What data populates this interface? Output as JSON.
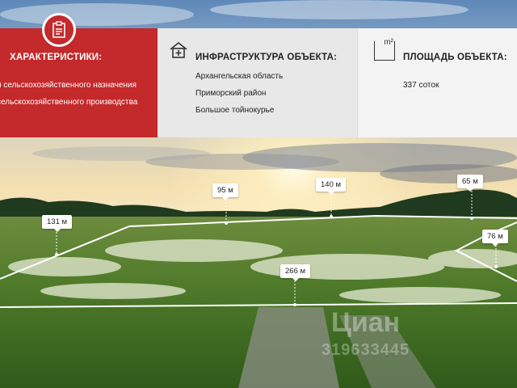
{
  "characteristics": {
    "title": "ХАРАКТЕРИСТИКИ:",
    "lines": [
      "и сельскохозяйственного назначения",
      "сельскохозяйственного производства"
    ],
    "badge_icon": "clipboard-icon"
  },
  "infrastructure": {
    "title": "ИНФРАСТРУКТУРА ОБЪЕКТА:",
    "icon": "house-plus-icon",
    "lines": [
      "Архангельская область",
      "Приморский район",
      "Большое тойнокурье"
    ]
  },
  "area": {
    "title": "ПЛОЩАДЬ ОБЪЕКТА:",
    "icon": "square-meter-icon",
    "icon_text": "m²",
    "value": "337 соток"
  },
  "measurements": [
    "95 м",
    "140 м",
    "65 м",
    "131 м",
    "76 м",
    "266 м"
  ],
  "watermark": {
    "brand": "Циан",
    "id": "319633445"
  },
  "colors": {
    "accent": "#c4292b",
    "panel": "#e8e8e8"
  }
}
